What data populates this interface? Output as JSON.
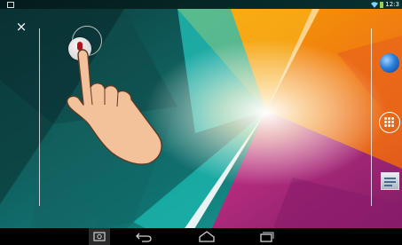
{
  "status_bar": {
    "time": "12:3",
    "icons": [
      "notification-icon",
      "wifi-icon",
      "battery-icon"
    ]
  },
  "toolbar": {
    "close_symbol": "×"
  },
  "hint": {
    "icons": [
      "record-button",
      "mic-icon",
      "hand-pointer"
    ],
    "record_color": "#b5121b"
  },
  "dock": {
    "items": [
      "globe-icon",
      "apps-button",
      "settings-icon"
    ]
  },
  "nav_bar": {
    "buttons": [
      "screenshot-button",
      "back-button",
      "home-button",
      "recent-apps-button"
    ]
  },
  "colors": {
    "accent_teal": "#1fbdb4",
    "accent_orange": "#f08a1c",
    "accent_magenta": "#c22a86"
  }
}
